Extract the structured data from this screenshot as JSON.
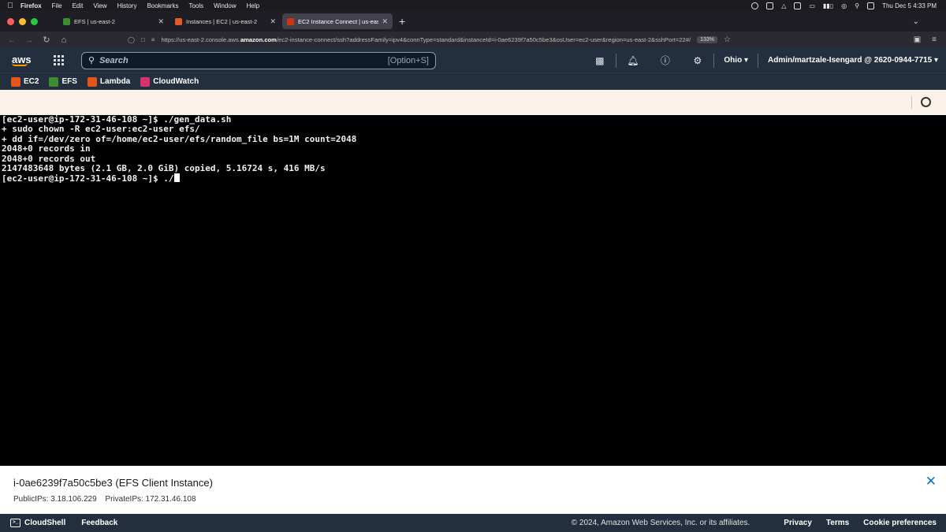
{
  "menubar": {
    "apple": "",
    "app": "Firefox",
    "items": [
      "File",
      "Edit",
      "View",
      "History",
      "Bookmarks",
      "Tools",
      "Window",
      "Help"
    ],
    "datetime": "Thu Dec 5  4:33 PM"
  },
  "tabs": [
    {
      "label": "EFS | us-east-2",
      "favicon_color": "#3d8c30",
      "active": false
    },
    {
      "label": "Instances | EC2 | us-east-2",
      "favicon_color": "#e05b2b",
      "active": false
    },
    {
      "label": "EC2 Instance Connect | us-east",
      "favicon_color": "#d13212",
      "active": true
    }
  ],
  "browser": {
    "url_prefix": "https://us-east-2.console.aws.",
    "url_domain": "amazon.com",
    "url_rest": "/ec2-instance-connect/ssh?addressFamily=ipv4&connType=standard&instanceId=i-0ae6239f7a50c5be3&osUser=ec2-user&region=us-east-2&sshPort=22#/",
    "zoom": "133%"
  },
  "aws_nav": {
    "logo": "aws",
    "search_placeholder": "Search",
    "search_shortcut": "[Option+S]",
    "region": "Ohio",
    "account": "Admin/martzale-Isengard @ 2620-0944-7715"
  },
  "favorites": [
    {
      "label": "EC2",
      "color": "#e8551c"
    },
    {
      "label": "EFS",
      "color": "#3d8c30"
    },
    {
      "label": "Lambda",
      "color": "#e8551c"
    },
    {
      "label": "CloudWatch",
      "color": "#d6336c"
    }
  ],
  "terminal": {
    "lines": [
      "[ec2-user@ip-172-31-46-108 ~]$ ./gen_data.sh",
      "+ sudo chown -R ec2-user:ec2-user efs/",
      "+ dd if=/dev/zero of=/home/ec2-user/efs/random_file bs=1M count=2048",
      "2048+0 records in",
      "2048+0 records out",
      "2147483648 bytes (2.1 GB, 2.0 GiB) copied, 5.16724 s, 416 MB/s"
    ],
    "prompt_line": "[ec2-user@ip-172-31-46-108 ~]$ ./"
  },
  "instance": {
    "name": "i-0ae6239f7a50c5be3 (EFS Client Instance)",
    "public_ips": "PublicIPs: 3.18.106.229",
    "private_ips": "PrivateIPs: 172.31.46.108"
  },
  "footer": {
    "cloudshell": "CloudShell",
    "feedback": "Feedback",
    "copyright": "© 2024, Amazon Web Services, Inc. or its affiliates.",
    "privacy": "Privacy",
    "terms": "Terms",
    "cookies": "Cookie preferences"
  }
}
